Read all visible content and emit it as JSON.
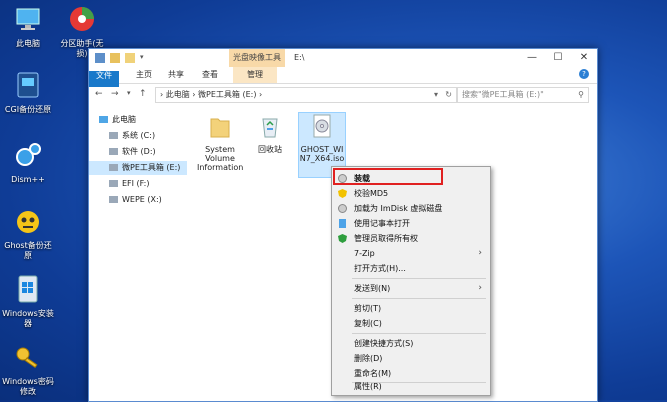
{
  "desktop": {
    "icons": [
      {
        "label": "此电脑",
        "icon": "this-pc-icon"
      },
      {
        "label": "分区助手(无损)",
        "icon": "partition-assistant-icon"
      },
      {
        "label": "CGI备份还原",
        "icon": "cgi-backup-icon"
      },
      {
        "label": "Dism++",
        "icon": "dism-icon"
      },
      {
        "label": "Ghost备份还原",
        "icon": "ghost-icon"
      },
      {
        "label": "Windows安装器",
        "icon": "windows-installer-icon"
      },
      {
        "label": "Windows密码修改",
        "icon": "windows-password-icon"
      }
    ]
  },
  "window": {
    "context_tab_header": "光盘映像工具",
    "title": "E:\\",
    "ribbon_tabs": [
      "文件",
      "主页",
      "共享",
      "查看",
      "管理"
    ],
    "address": [
      "此电脑",
      "微PE工具箱 (E:)"
    ],
    "search_placeholder": "搜索\"微PE工具箱 (E:)\"",
    "nav_items": [
      {
        "label": "此电脑",
        "selected": false
      },
      {
        "label": "系统 (C:)",
        "selected": false
      },
      {
        "label": "软件 (D:)",
        "selected": false
      },
      {
        "label": "微PE工具箱 (E:)",
        "selected": true
      },
      {
        "label": "EFI (F:)",
        "selected": false
      },
      {
        "label": "WEPE (X:)",
        "selected": false
      }
    ],
    "files": [
      {
        "name": "System Volume Information",
        "icon": "folder-icon"
      },
      {
        "name": "回收站",
        "icon": "recycle-bin-icon"
      },
      {
        "name": "GHOST_WIN7_X64.iso",
        "icon": "disc-image-icon"
      }
    ]
  },
  "context_menu": {
    "highlighted": "装载",
    "items": [
      {
        "label": "装载",
        "icon": "disc-icon",
        "bold": true
      },
      {
        "label": "校验MD5",
        "icon": "shield-warning-icon"
      },
      {
        "label": "加载为 ImDisk 虚拟磁盘",
        "icon": "disc-icon"
      },
      {
        "label": "使用记事本打开",
        "icon": "notepad-icon"
      },
      {
        "label": "管理员取得所有权",
        "icon": "shield-check-icon"
      },
      {
        "label": "7-Zip",
        "submenu": true
      },
      {
        "label": "打开方式(H)..."
      },
      {
        "label": "发送到(N)",
        "submenu": true
      },
      {
        "label": "剪切(T)"
      },
      {
        "label": "复制(C)"
      },
      {
        "label": "创建快捷方式(S)"
      },
      {
        "label": "删除(D)"
      },
      {
        "label": "重命名(M)"
      },
      {
        "label": "属性(R)"
      }
    ]
  },
  "colors": {
    "accent": "#1979ca",
    "highlight_border": "#e02020",
    "selection": "#cce8ff"
  }
}
